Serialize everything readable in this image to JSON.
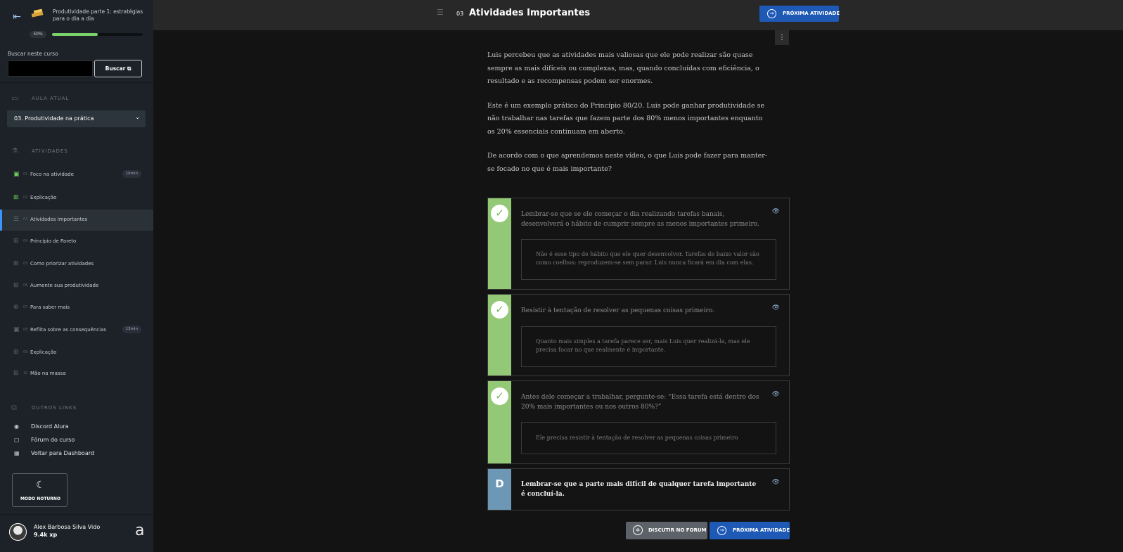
{
  "sidebar": {
    "course_title": "Produtividade parte 1: estratégias para o dia a dia",
    "progress_label": "50%",
    "progress_value": 0.5,
    "search_label": "Buscar neste curso",
    "search_value": "",
    "search_button": "Buscar",
    "current_lesson_heading": "AULA ATUAL",
    "current_lesson": "03. Produtividade na prática",
    "activities_heading": "ATIVIDADES",
    "activities": [
      {
        "num": "01",
        "label": "Foco na atividade",
        "time": "10min",
        "icon": "video-icon"
      },
      {
        "num": "02",
        "label": "Explicação",
        "time": "",
        "icon": "book-icon"
      },
      {
        "num": "03",
        "label": "Atividades importantes",
        "time": "",
        "icon": "list-icon"
      },
      {
        "num": "04",
        "label": "Princípio de Pareto",
        "time": "",
        "icon": "book-icon"
      },
      {
        "num": "05",
        "label": "Como priorizar atividades",
        "time": "",
        "icon": "book-icon"
      },
      {
        "num": "06",
        "label": "Aumente sua produtividade",
        "time": "",
        "icon": "book-icon"
      },
      {
        "num": "07",
        "label": "Para saber mais",
        "time": "",
        "icon": "plus-circle-icon"
      },
      {
        "num": "08",
        "label": "Reflita sobre as consequências",
        "time": "13min",
        "icon": "video-icon"
      },
      {
        "num": "09",
        "label": "Explicação",
        "time": "",
        "icon": "book-icon"
      },
      {
        "num": "10",
        "label": "Mão na massa",
        "time": "",
        "icon": "book-icon"
      }
    ],
    "other_links_heading": "OUTROS LINKS",
    "links": [
      {
        "label": "Discord Alura",
        "icon": "discord-icon"
      },
      {
        "label": "Fórum do curso",
        "icon": "chat-icon"
      },
      {
        "label": "Voltar para Dashboard",
        "icon": "dashboard-icon"
      }
    ],
    "night_mode_label": "MODO NOTURNO",
    "user_name": "Alex Barbosa Silva Vido",
    "user_xp": "9.4k xp"
  },
  "topbar": {
    "activity_number": "03",
    "activity_title": "Atividades Importantes",
    "next_button": "PRÓXIMA ATIVIDADE"
  },
  "content": {
    "paragraphs": [
      "Luis percebeu que as atividades mais valiosas que ele pode realizar são quase sempre as mais difíceis ou complexas, mas, quando concluídas com eficiência, o resultado e as recompensas podem ser enormes.",
      "Este é um exemplo prático do Princípio 80/20. Luis pode ganhar produtividade se não trabalhar nas tarefas que fazem parte dos 80% menos importantes enquanto os 20% essenciais continuam em aberto.",
      "De acordo com o que aprendemos neste vídeo, o que Luis pode fazer para manter-se focado no que é mais importante?"
    ],
    "options": [
      {
        "text": "Lembrar-se que se ele começar o dia realizando tarefas banais, desenvolverá o hábito de cumprir sempre as menos importantes primeiro.",
        "feedback": "Não é esse tipo de hábito que ele quer desenvolver. Tarefas de baixo valor são como coelhos: reproduzem-se sem parar. Luis nunca ficará em dia com elas."
      },
      {
        "text": "Resistir à tentação de resolver as pequenas coisas primeiro.",
        "feedback": "Quanto mais simples a tarefa parece ser, mais Luis quer realizá-la, mas ele precisa focar no que realmente é importante."
      },
      {
        "text": "Antes dele começar a trabalhar, pergunte-se: “Essa tarefa está dentro dos 20% mais importantes ou nos outros 80%?”",
        "feedback": "Ele precisa resistir à tentação de resolver as pequenas coisas primeiro"
      },
      {
        "letter": "D",
        "text": "Lembrar-se que a parte mais difícil de qualquer tarefa importante é concluí-la."
      }
    ],
    "forum_button": "DISCUTIR NO FORUM",
    "next_button": "PRÓXIMA ATIVIDADE"
  },
  "colors": {
    "accent_blue": "#1e59b6",
    "correct_green": "#93c876",
    "letter_marker": "#6d98b5",
    "progress_green": "#7ad169"
  }
}
